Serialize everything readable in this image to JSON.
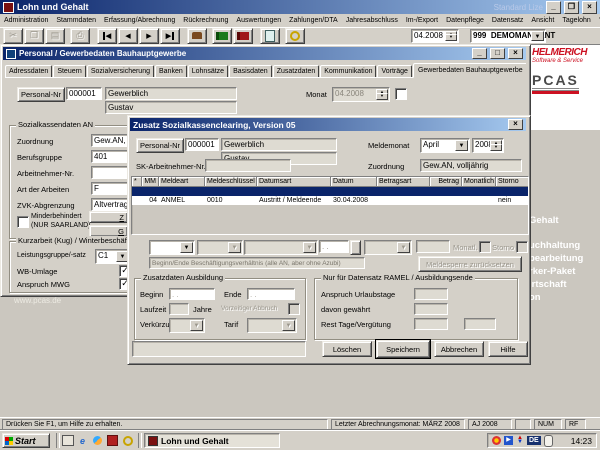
{
  "app": {
    "title": "Lohn und Gehalt",
    "license_text": "Standard Lize",
    "menus": [
      "Administration",
      "Stammdaten",
      "Erfassung/Abrechnung",
      "Rückrechnung",
      "Auswertungen",
      "Zahlungen/DTA",
      "Jahresabschluss",
      "Im-/Export",
      "Datenpflege",
      "Datensatz",
      "Ansicht",
      "Tagelohn",
      "?"
    ],
    "toolbar": {
      "period": "04.2008",
      "mandant_nr": "999",
      "mandant_name": "DEMOMANDANT"
    },
    "statusbar": {
      "help": "Drücken Sie F1, um Hilfe zu erhalten.",
      "last_month": "Letzter Abrechnungsmonat: MÄRZ 2008",
      "year": "AJ 2008",
      "num": "NUM",
      "rf": "RF"
    }
  },
  "branding": {
    "helmerich": "HELMERICH",
    "tagline": "Software & Service",
    "pcas": "PCAS",
    "products": [
      "Gehalt",
      "uchhaltung",
      "bearbeitung",
      "rker-Paket",
      "irtschaft",
      "on"
    ],
    "website": "www.pcas.de"
  },
  "personal": {
    "title": "Personal / Gewerbedaten Bauhauptgewerbe",
    "tabs": [
      {
        "label": "Adressdaten"
      },
      {
        "label": "Steuern"
      },
      {
        "label": "Sozialversicherung"
      },
      {
        "label": "Banken"
      },
      {
        "label": "Lohnsätze"
      },
      {
        "label": "Basisdaten"
      },
      {
        "label": "Zusatzdaten"
      },
      {
        "label": "Kommunikation"
      },
      {
        "label": "Vorträge"
      },
      {
        "label": "Gewerbedaten Bauhauptgewerbe",
        "active": true
      }
    ],
    "personalnr_label": "Personal-Nr",
    "personalnr": "000001",
    "name": "Gewerblich",
    "firstname": "Gustav",
    "monat_label": "Monat",
    "monat": "04.2008",
    "sozialkassen": {
      "legend": "Sozialkassendaten AN",
      "zuordnung_label": "Zuordnung",
      "zuordnung": "Gew.AN, v",
      "berufsgruppe_label": "Berufsgruppe",
      "berufsgruppe": "401",
      "arbeitnehmernr_label": "Arbeitnehmer-Nr.",
      "arbeitnehmernr": "",
      "artderarbeiten_label": "Art der Arbeiten",
      "artderarbeiten": "F",
      "zvk_label": "ZVK-Abgrenzung",
      "zvk": "Altvertrag b",
      "behindert_line1": "Minderbehindert",
      "behindert_line2": "(NUR SAARLAND)",
      "btn_z": "Z",
      "btn_g": "G"
    },
    "kurzarbeit": {
      "legend": "Kurzarbeit (Kug) / Winterbeschäftigu",
      "leistungsgruppe_label": "Leistungsgruppe/-satz",
      "leistungsgruppe": "C1",
      "wb_label": "WB-Umlage",
      "mwg_label": "Anspruch MWG"
    }
  },
  "dialog": {
    "title": "Zusatz Sozialkassenclearing, Version 05",
    "personalnr_label": "Personal-Nr",
    "personalnr": "000001",
    "name": "Gewerblich",
    "firstname": "Gustav",
    "meldemonat_label": "Meldemonat",
    "month": "April",
    "year": "2008",
    "sknr_label": "SK-Arbeitnehmer-Nr.",
    "sknr": "",
    "zuordnung_label": "Zuordnung",
    "zuordnung": "Gew.AN, volljährig",
    "table": {
      "headers": [
        "*",
        "MM",
        "Meldeart",
        "Meldeschlüssel",
        "Datumsart",
        "Datum",
        "Betragsart",
        "Betrag",
        "Monatlich",
        "Storno"
      ],
      "row": [
        "",
        "04",
        "ANMEL",
        "0010",
        "Austritt / Meldeende",
        "30.04.2008",
        "",
        "",
        "",
        "nein"
      ]
    },
    "date_mask": " .  .",
    "monatl_label": "Monatl.",
    "storno_label": "Storno",
    "info_text": "Beginn/Ende Beschäftigungsverhältnis (alle AN, aber ohne Azubi)",
    "meldesperre_label": "Meldesperre zurücksetzen",
    "ausbildung": {
      "legend": "Zusatzdaten Ausbildung",
      "beginn_label": "Beginn",
      "ende_label": "Ende",
      "laufzeit_label": "Laufzeit",
      "jahre_label": "Jahre",
      "abbruch_label": "Vorzeitiger Abbruch",
      "verkuerzung_label": "Verkürzung",
      "tarif_label": "Tarif"
    },
    "ramel": {
      "legend": "Nur für Datensatz RAMEL / Ausbildungsende",
      "anspruch_label": "Anspruch Urlaubstage",
      "davon_label": "davon gewährt",
      "rest_label": "Rest Tage/Vergütung"
    },
    "buttons": {
      "loeschen": "Löschen",
      "speichern": "Speichern",
      "abbrechen": "Abbrechen",
      "hilfe": "Hilfe"
    }
  },
  "taskbar": {
    "start": "Start",
    "task": "Lohn und Gehalt",
    "lang": "DE",
    "time": "14:23"
  }
}
